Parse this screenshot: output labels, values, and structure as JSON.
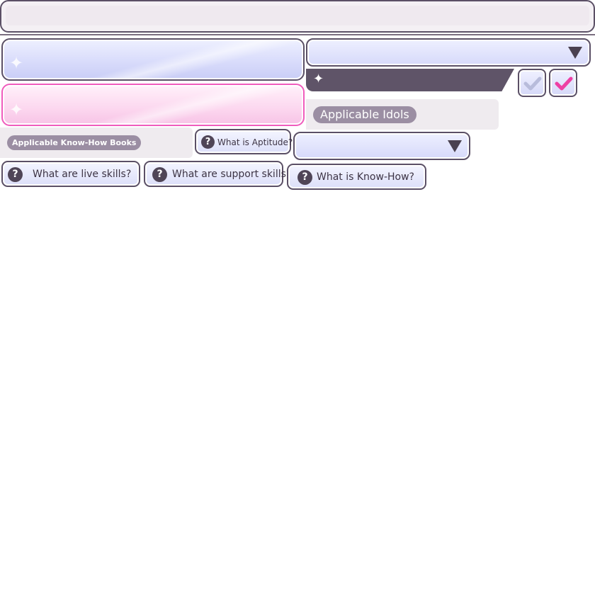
{
  "tags": {
    "applicable_idols": "Applicable Idols",
    "applicable_know_how_books": "Applicable Know-How Books"
  },
  "help": {
    "aptitude": "What is Aptitude?",
    "live_skills": "What are live skills?",
    "support_skills": "What are support skills?",
    "know_how": "What is Know-How?",
    "icon_glyph": "?"
  },
  "icons": {
    "sparkle": "sparkle-icon",
    "dropdown": "chevron-down-icon",
    "check": "check-icon",
    "help": "question-icon"
  },
  "colors": {
    "border": "#5b5066",
    "accent_pink": "#f05cbd",
    "ribbon": "#5f5468",
    "pill": "#9b8ea3",
    "check_on": "#ee3fa4",
    "check_off": "#b8bcdb"
  },
  "checkboxes": [
    {
      "checked": false
    },
    {
      "checked": true
    }
  ]
}
